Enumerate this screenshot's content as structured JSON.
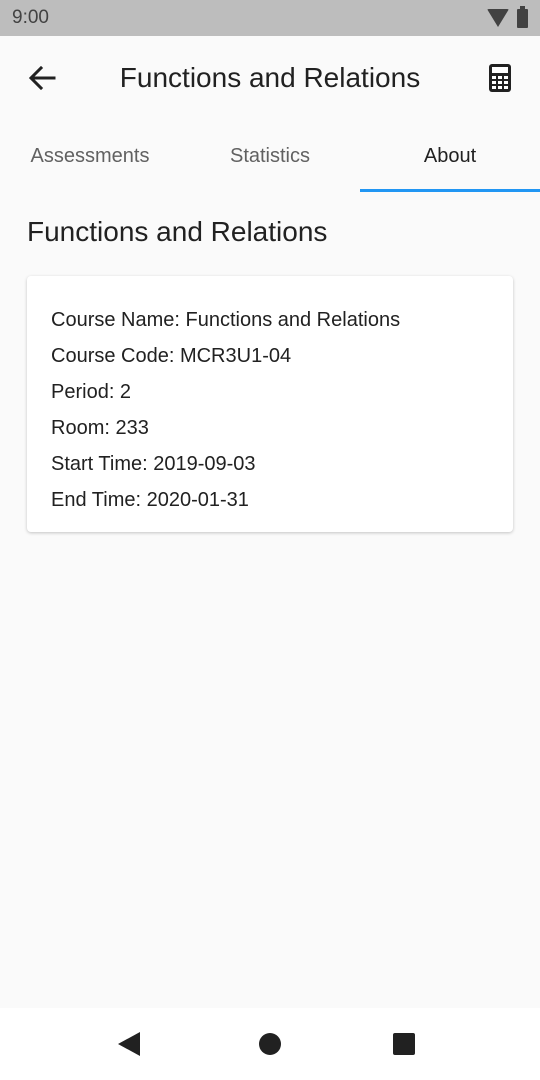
{
  "status_bar": {
    "time": "9:00",
    "icons": [
      "wifi-icon",
      "battery-icon"
    ]
  },
  "app_bar": {
    "title": "Functions and Relations",
    "back_icon": "arrow-left-icon",
    "action_icon": "calculator-icon"
  },
  "tabs": [
    {
      "label": "Assessments",
      "active": false
    },
    {
      "label": "Statistics",
      "active": false
    },
    {
      "label": "About",
      "active": true
    }
  ],
  "colors": {
    "accent": "#2196f3",
    "status_bar": "#bdbdbd",
    "background": "#fafafa"
  },
  "about": {
    "heading": "Functions and Relations",
    "details": [
      "Course Name: Functions and Relations",
      "Course Code: MCR3U1-04",
      "Period: 2",
      "Room: 233",
      "Start Time: 2019-09-03",
      "End Time: 2020-01-31"
    ]
  },
  "nav_bar": {
    "icons": [
      "back-triangle-icon",
      "home-circle-icon",
      "recents-square-icon"
    ]
  }
}
